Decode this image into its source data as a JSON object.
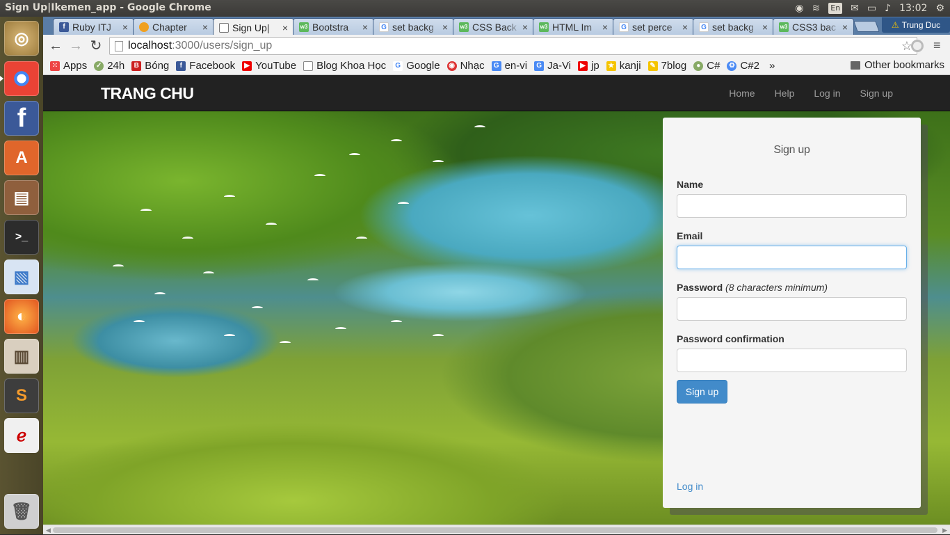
{
  "window": {
    "title": "Sign Up|Ikemen_app - Google Chrome"
  },
  "tray": {
    "lang": "En",
    "time": "13:02"
  },
  "tabs": [
    {
      "label": "Ruby ITJ",
      "favicon": "facebook-icon",
      "color": "#3b5998",
      "glyph": "f"
    },
    {
      "label": "Chapter",
      "favicon": "ring-icon",
      "color": "#f0a020",
      "glyph": "O"
    },
    {
      "label": "Sign Up|",
      "favicon": "page-icon",
      "color": "#ffffff",
      "glyph": ""
    },
    {
      "label": "Bootstra",
      "favicon": "w3-icon",
      "color": "#5cb85c",
      "glyph": "w3"
    },
    {
      "label": "set backg",
      "favicon": "google-icon",
      "color": "#4285f4",
      "glyph": "G"
    },
    {
      "label": "CSS Back",
      "favicon": "w3-icon",
      "color": "#5cb85c",
      "glyph": "w3"
    },
    {
      "label": "HTML Im",
      "favicon": "w3-icon",
      "color": "#5cb85c",
      "glyph": "w3"
    },
    {
      "label": "set perce",
      "favicon": "google-icon",
      "color": "#4285f4",
      "glyph": "G"
    },
    {
      "label": "set backg",
      "favicon": "google-icon",
      "color": "#4285f4",
      "glyph": "G"
    },
    {
      "label": "CSS3 bac",
      "favicon": "w3-icon",
      "color": "#5cb85c",
      "glyph": "w3"
    }
  ],
  "profile": {
    "name": "Trung Duc"
  },
  "address": {
    "host": "localhost",
    "path": ":3000/users/sign_up"
  },
  "bookmarks": [
    {
      "label": "Apps",
      "color": "#e44"
    },
    {
      "label": "24h",
      "color": "#8a6"
    },
    {
      "label": "Bóng",
      "color": "#c22"
    },
    {
      "label": "Facebook",
      "color": "#3b5998"
    },
    {
      "label": "YouTube",
      "color": "#e00"
    },
    {
      "label": "Blog Khoa Học",
      "color": "#aaa"
    },
    {
      "label": "Google",
      "color": "#4285f4"
    },
    {
      "label": "Nhạc",
      "color": "#d33"
    },
    {
      "label": "en-vi",
      "color": "#4a8af4"
    },
    {
      "label": "Ja-Vi",
      "color": "#4a8af4"
    },
    {
      "label": "jp",
      "color": "#e00"
    },
    {
      "label": "kanji",
      "color": "#f5c400"
    },
    {
      "label": "7blog",
      "color": "#f5c400"
    },
    {
      "label": "C#",
      "color": "#8a6"
    },
    {
      "label": "C#2",
      "color": "#4a8af4"
    }
  ],
  "bookmarks_more": "»",
  "other_bookmarks": "Other bookmarks",
  "navbar": {
    "brand": "TRANG CHU",
    "links": [
      "Home",
      "Help",
      "Log in",
      "Sign up"
    ]
  },
  "form": {
    "title": "Sign up",
    "name_label": "Name",
    "email_label": "Email",
    "password_label": "Password",
    "password_hint": "(8 characters minimum)",
    "confirm_label": "Password confirmation",
    "submit": "Sign up",
    "login_link": "Log in"
  },
  "launcher": [
    {
      "name": "ubuntu-dash-icon",
      "color": "#c9a25a"
    },
    {
      "name": "chrome-icon",
      "color": "#d9a93a"
    },
    {
      "name": "facebook-app-icon",
      "color": "#3b5998"
    },
    {
      "name": "software-center-icon",
      "color": "#e0662b"
    },
    {
      "name": "files-icon",
      "color": "#9b5b3a"
    },
    {
      "name": "terminal-icon",
      "color": "#2c2c2c"
    },
    {
      "name": "writer-icon",
      "color": "#3c79c9"
    },
    {
      "name": "firefox-icon",
      "color": "#e66a1f"
    },
    {
      "name": "ebook-reader-icon",
      "color": "#7a6a55"
    },
    {
      "name": "sublime-text-icon",
      "color": "#444"
    },
    {
      "name": "pdf-reader-icon",
      "color": "#eee"
    },
    {
      "name": "trash-icon",
      "color": "#777"
    }
  ]
}
